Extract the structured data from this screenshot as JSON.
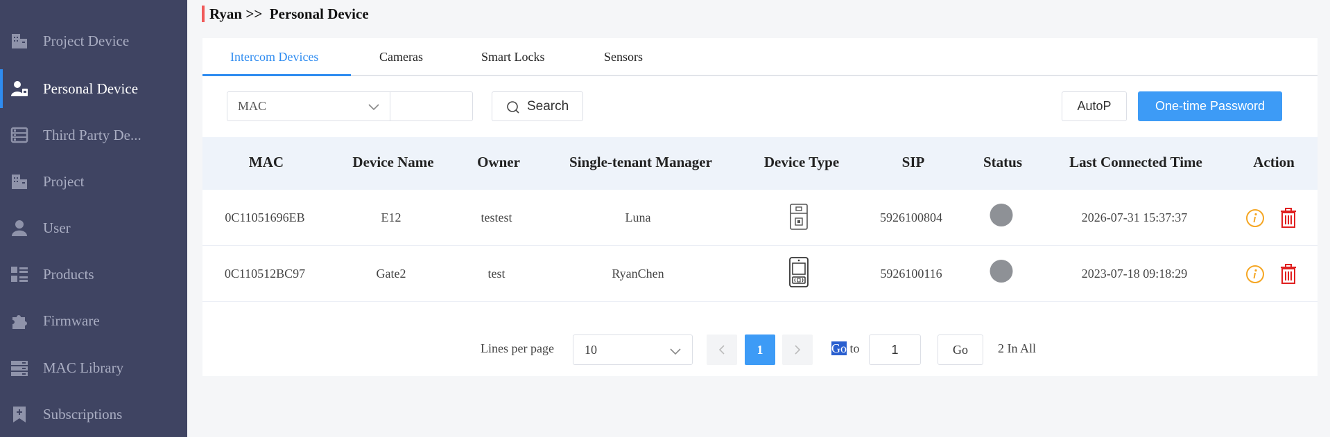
{
  "sidebar": {
    "items": [
      {
        "label": "Project Device",
        "icon": "building-icon",
        "active": false
      },
      {
        "label": "Personal Device",
        "icon": "user-device-icon",
        "active": true
      },
      {
        "label": "Third Party De...",
        "icon": "list-server-icon",
        "active": false
      },
      {
        "label": "Project",
        "icon": "project-building-icon",
        "active": false
      },
      {
        "label": "User",
        "icon": "user-icon",
        "active": false
      },
      {
        "label": "Products",
        "icon": "products-grid-icon",
        "active": false
      },
      {
        "label": "Firmware",
        "icon": "puzzle-icon",
        "active": false
      },
      {
        "label": "MAC Library",
        "icon": "server-stack-icon",
        "active": false
      },
      {
        "label": "Subscriptions",
        "icon": "bookmark-plus-icon",
        "active": false
      }
    ]
  },
  "breadcrumb": {
    "text": "Ryan >>  Personal Device"
  },
  "tabs": [
    {
      "label": "Intercom Devices",
      "active": true
    },
    {
      "label": "Cameras",
      "active": false
    },
    {
      "label": "Smart Locks",
      "active": false
    },
    {
      "label": "Sensors",
      "active": false
    }
  ],
  "filter": {
    "field": "MAC",
    "value": "",
    "search_label": "Search",
    "autop_label": "AutoP",
    "otp_label": "One-time Password"
  },
  "table": {
    "columns": [
      "MAC",
      "Device Name",
      "Owner",
      "Single-tenant Manager",
      "Device Type",
      "SIP",
      "Status",
      "Last Connected Time",
      "Action"
    ],
    "rows": [
      {
        "mac": "0C11051696EB",
        "name": "E12",
        "owner": "testest",
        "manager": "Luna",
        "type_icon": "door-phone-icon",
        "sip": "5926100804",
        "status": "offline",
        "time": "2026-07-31 15:37:37"
      },
      {
        "mac": "0C110512BC97",
        "name": "Gate2",
        "owner": "test",
        "manager": "RyanChen",
        "type_icon": "gate-station-icon",
        "sip": "5926100116",
        "status": "offline",
        "time": "2023-07-18 09:18:29"
      }
    ]
  },
  "pagination": {
    "lines_label": "Lines per page",
    "page_size": "10",
    "current_page": "1",
    "goto_hl": "Go",
    "goto_rest": " to",
    "goto_value": "1",
    "go_label": "Go",
    "total": "2 In All"
  },
  "colors": {
    "accent": "#3d9bf6",
    "sidebar": "#3f4462",
    "danger": "#e02020",
    "info": "#f5a623"
  }
}
